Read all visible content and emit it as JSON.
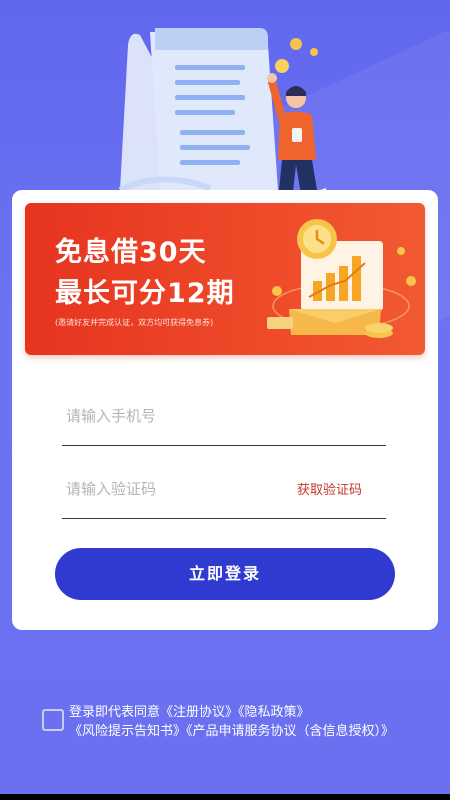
{
  "promo": {
    "line1": "免息借30天",
    "line2": "最长可分12期",
    "note": "(邀请好友并完成认证，双方均可获得免息券)"
  },
  "form": {
    "phone_placeholder": "请输入手机号",
    "code_placeholder": "请输入验证码",
    "get_code_label": "获取验证码",
    "login_label": "立即登录"
  },
  "agreement": {
    "prefix": "登录即代表同意",
    "links": [
      "《注册协议》",
      "《隐私政策》",
      "《风险提示告知书》",
      "《产品申请服务协议（含信息授权）》"
    ],
    "checked": false
  },
  "colors": {
    "background": "#6a70f0",
    "promo": "#e6341f",
    "button": "#2f3bd0",
    "get_code": "#c0392b"
  }
}
